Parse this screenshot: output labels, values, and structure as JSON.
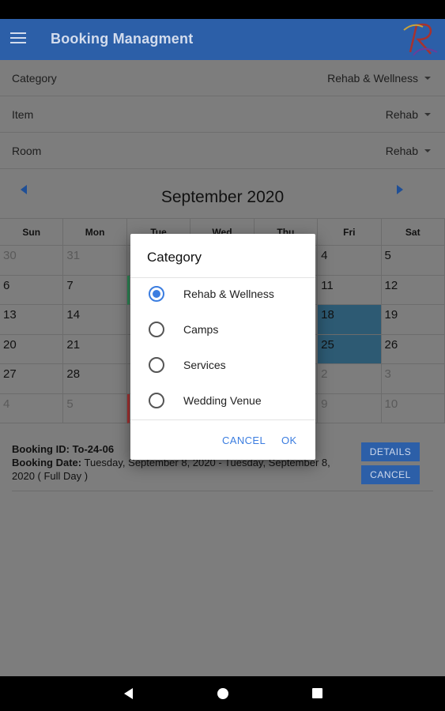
{
  "app_bar": {
    "title": "Booking Managment",
    "menu_icon": "hamburger-menu-icon",
    "logo_icon": "r-logo-icon",
    "color": "#2c5fa8"
  },
  "filters": [
    {
      "label": "Category",
      "value": "Rehab & Wellness"
    },
    {
      "label": "Item",
      "value": "Rehab"
    },
    {
      "label": "Room",
      "value": "Rehab"
    }
  ],
  "calendar": {
    "month_title": "September 2020",
    "weekdays": [
      "Sun",
      "Mon",
      "Tue",
      "Wed",
      "Thu",
      "Fri",
      "Sat"
    ],
    "weeks": [
      [
        {
          "d": "30",
          "dim": true
        },
        {
          "d": "31",
          "dim": true
        },
        {
          "d": ""
        },
        {
          "d": ""
        },
        {
          "d": ""
        },
        {
          "d": "4"
        },
        {
          "d": "5"
        }
      ],
      [
        {
          "d": "6"
        },
        {
          "d": "7"
        },
        {
          "d": "",
          "mark": "green"
        },
        {
          "d": ""
        },
        {
          "d": ""
        },
        {
          "d": "11"
        },
        {
          "d": "12"
        }
      ],
      [
        {
          "d": "13"
        },
        {
          "d": "14"
        },
        {
          "d": ""
        },
        {
          "d": ""
        },
        {
          "d": ""
        },
        {
          "d": "18",
          "booked": true
        },
        {
          "d": "19"
        }
      ],
      [
        {
          "d": "20"
        },
        {
          "d": "21"
        },
        {
          "d": ""
        },
        {
          "d": ""
        },
        {
          "d": ""
        },
        {
          "d": "25",
          "booked": true
        },
        {
          "d": "26"
        }
      ],
      [
        {
          "d": "27"
        },
        {
          "d": "28"
        },
        {
          "d": ""
        },
        {
          "d": ""
        },
        {
          "d": ""
        },
        {
          "d": "2",
          "dim": true
        },
        {
          "d": "3",
          "dim": true
        }
      ],
      [
        {
          "d": "4",
          "dim": true
        },
        {
          "d": "5",
          "dim": true
        },
        {
          "d": "",
          "mark": "red"
        },
        {
          "d": ""
        },
        {
          "d": ""
        },
        {
          "d": "9",
          "dim": true
        },
        {
          "d": "10",
          "dim": true
        }
      ]
    ]
  },
  "booking": {
    "id_label": "Booking ID:",
    "id_value": "To-24-06",
    "date_label": "Booking Date:",
    "date_value": "Tuesday, September 8, 2020 - Tuesday, September 8, 2020 ( Full Day )",
    "details_button": "DETAILS",
    "cancel_button": "CANCEL"
  },
  "dialog": {
    "title": "Category",
    "options": [
      "Rehab & Wellness",
      "Camps",
      "Services",
      "Wedding Venue"
    ],
    "selected_index": 0,
    "cancel_label": "CANCEL",
    "ok_label": "OK",
    "accent": "#3b7de0"
  }
}
